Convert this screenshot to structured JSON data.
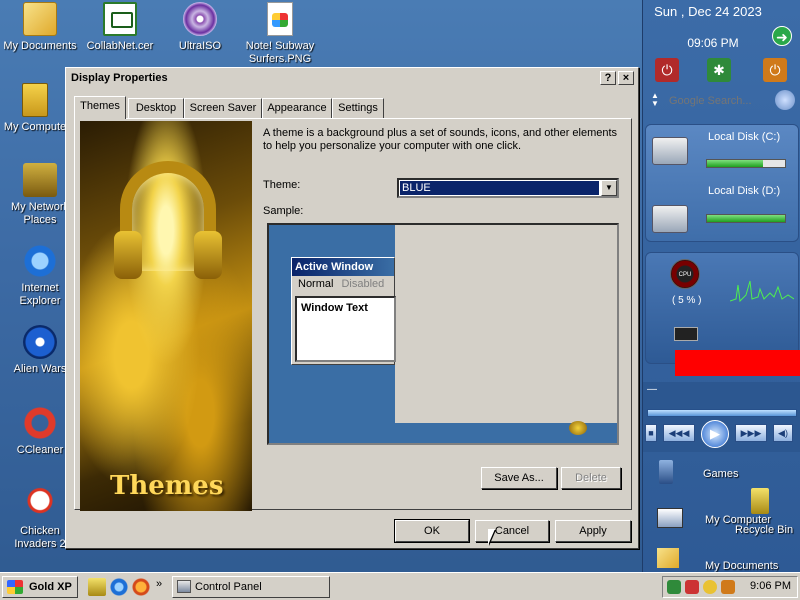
{
  "desktop": {
    "icons": [
      {
        "label": "My Documents",
        "icon": "folder-icon"
      },
      {
        "label": "CollabNet.cer",
        "icon": "certificate-icon"
      },
      {
        "label": "UltraISO",
        "icon": "disc-icon"
      },
      {
        "label": "Note! Subway Surfers.PNG",
        "icon": "png-file-icon"
      },
      {
        "label": "My Compute",
        "icon": "computer-icon"
      },
      {
        "label": "My Network Places",
        "icon": "network-icon"
      },
      {
        "label": "Internet Explorer",
        "icon": "ie-icon"
      },
      {
        "label": "Alien Wars",
        "icon": "alien-icon"
      },
      {
        "label": "CCleaner",
        "icon": "ccleaner-icon"
      },
      {
        "label": "Chicken Invaders 2",
        "icon": "chicken-icon"
      }
    ]
  },
  "sidebar": {
    "date": "Sun , Dec 24 2023",
    "time": "09:06 PM",
    "search_placeholder": "Google Search...",
    "disks": [
      {
        "label": "Local Disk (C:)",
        "used": 0.72
      },
      {
        "label": "Local Disk (D:)",
        "used": 1.0
      }
    ],
    "cpu_label": "CPU",
    "cpu_percent": "( 5 % )",
    "links": [
      {
        "label": "Games"
      },
      {
        "label": "My Computer"
      },
      {
        "label": "Recycle Bin"
      },
      {
        "label": "My Documents"
      }
    ],
    "colors": {
      "accent": "#2f5a90",
      "alert": "#ff0000",
      "meter": "#1f9f1f"
    }
  },
  "window": {
    "title": "Display Properties",
    "help_btn": "?",
    "close_btn": "×",
    "tabs": [
      {
        "label": "Themes",
        "active": true
      },
      {
        "label": "Desktop"
      },
      {
        "label": "Screen Saver"
      },
      {
        "label": "Appearance"
      },
      {
        "label": "Settings"
      }
    ],
    "banner_text": "Themes",
    "description": "A theme is a background plus a set of sounds, icons, and other elements to help you personalize your computer with one click.",
    "theme_label": "Theme:",
    "theme_value": "BLUE",
    "sample_label": "Sample:",
    "sample": {
      "active_window": "Active Window",
      "menu_normal": "Normal",
      "menu_disabled": "Disabled",
      "window_text": "Window Text"
    },
    "buttons": {
      "save_as": "Save As...",
      "delete": "Delete",
      "ok": "OK",
      "cancel": "Cancel",
      "apply": "Apply"
    }
  },
  "taskbar": {
    "start_label": "Gold XP",
    "overflow": "»",
    "tasks": [
      {
        "label": "Control Panel"
      }
    ],
    "clock": "9:06 PM"
  }
}
